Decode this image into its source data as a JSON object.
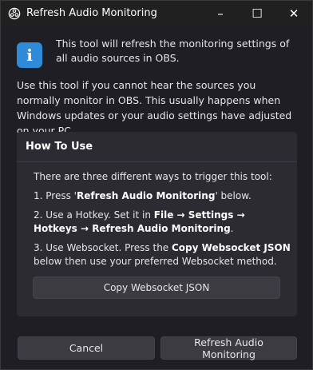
{
  "window": {
    "title": "Refresh Audio Monitoring",
    "minimize_glyph": "–",
    "maximize_glyph": "☐",
    "close_glyph": "✕"
  },
  "info_icon": {
    "glyph": "i",
    "color": "#2f8ad8"
  },
  "intro": "This tool will refresh the monitoring settings of all audio sources in OBS.",
  "description": "Use this tool if you cannot hear the sources you normally monitor in OBS. This usually happens when Windows updates or your audio settings have adjusted on your PC.",
  "how_to_use": {
    "title": "How To Use",
    "intro": "There are three different ways to trigger this tool:",
    "step1": {
      "prefix": "1. Press '",
      "bold": "Refresh Audio Monitoring",
      "suffix": "' below."
    },
    "step2": {
      "prefix": "2. Use a Hotkey. Set it in ",
      "bold": "File → Settings → Hotkeys → Refresh Audio Monitoring",
      "suffix": "."
    },
    "step3": {
      "prefix": "3. Use Websocket. Press the ",
      "bold": "Copy Websocket JSON",
      "suffix": " below then use your preferred Websocket method."
    },
    "copy_button": "Copy Websocket JSON"
  },
  "footer": {
    "cancel": "Cancel",
    "refresh": "Refresh Audio Monitoring"
  }
}
